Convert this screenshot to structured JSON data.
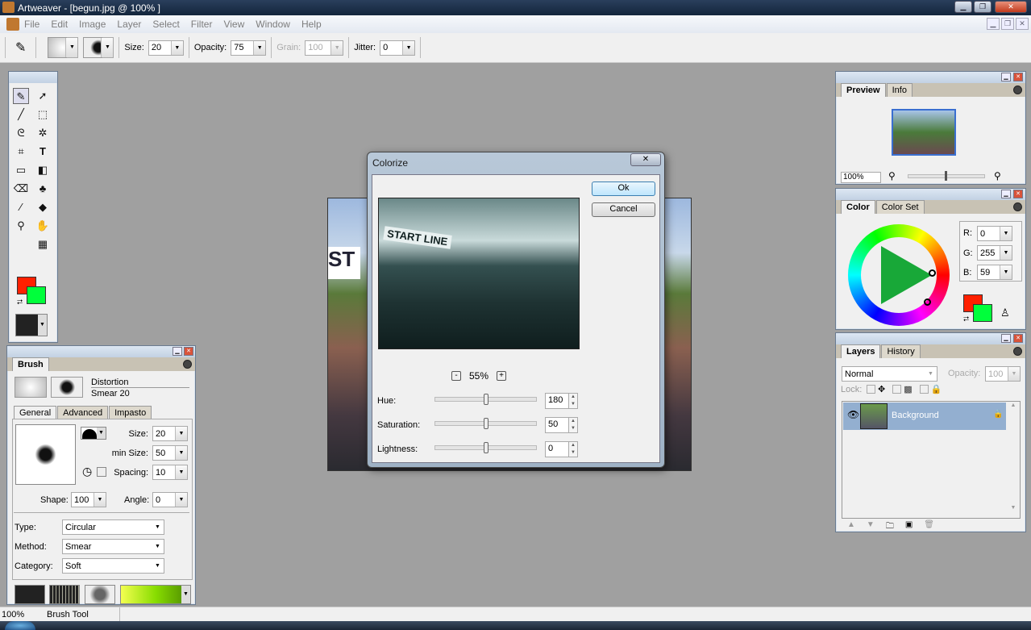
{
  "window": {
    "title": "Artweaver - [begun.jpg @ 100% ]"
  },
  "menu": [
    "File",
    "Edit",
    "Image",
    "Layer",
    "Select",
    "Filter",
    "View",
    "Window",
    "Help"
  ],
  "toolbar": {
    "size_label": "Size:",
    "size": "20",
    "opacity_label": "Opacity:",
    "opacity": "75",
    "grain_label": "Grain:",
    "grain": "100",
    "jitter_label": "Jitter:",
    "jitter": "0"
  },
  "brush_panel": {
    "title": "Brush",
    "category": "Distortion",
    "variant": "Smear 20",
    "tabs": [
      "General",
      "Advanced",
      "Impasto"
    ],
    "size_label": "Size:",
    "size": "20",
    "min_size_label": "min Size:",
    "min_size": "50",
    "spacing_label": "Spacing:",
    "spacing": "10",
    "shape_label": "Shape:",
    "shape": "100",
    "angle_label": "Angle:",
    "angle": "0",
    "type_label": "Type:",
    "type": "Circular",
    "method_label": "Method:",
    "method": "Smear",
    "category_label": "Category:",
    "category_value": "Soft"
  },
  "colors": {
    "primary": "#ff2000",
    "secondary": "#00ff3b"
  },
  "dialog": {
    "title": "Colorize",
    "ok": "Ok",
    "cancel": "Cancel",
    "zoom": "55%",
    "hue_label": "Hue:",
    "hue": "180",
    "saturation_label": "Saturation:",
    "saturation": "50",
    "lightness_label": "Lightness:",
    "lightness": "0",
    "preview_text": "START LINE"
  },
  "preview_panel": {
    "tabs": [
      "Preview",
      "Info"
    ],
    "zoom": "100%"
  },
  "color_panel": {
    "tabs": [
      "Color",
      "Color Set"
    ],
    "r_label": "R:",
    "r": "0",
    "g_label": "G:",
    "g": "255",
    "b_label": "B:",
    "b": "59"
  },
  "layers_panel": {
    "tabs": [
      "Layers",
      "History"
    ],
    "blend": "Normal",
    "opacity_label": "Opacity:",
    "opacity": "100",
    "lock_label": "Lock:",
    "layers": [
      {
        "name": "Background"
      }
    ]
  },
  "statusbar": {
    "zoom": "100%",
    "tool": "Brush Tool"
  }
}
